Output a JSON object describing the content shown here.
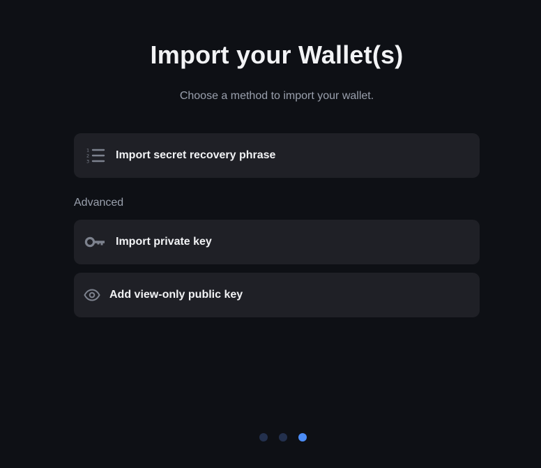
{
  "header": {
    "title": "Import your Wallet(s)",
    "subtitle": "Choose a method to import your wallet."
  },
  "options": [
    {
      "label": "Import secret recovery phrase",
      "icon": "numbered-list-icon"
    },
    {
      "label": "Import private key",
      "icon": "key-icon"
    },
    {
      "label": "Add view-only public key",
      "icon": "eye-icon"
    }
  ],
  "advanced_label": "Advanced",
  "pagination": {
    "total": 3,
    "current": 3
  },
  "colors": {
    "background": "#0e1015",
    "card": "#1f2026",
    "text_primary": "#f2f3f5",
    "text_secondary": "#9aa0ad",
    "icon": "#7d828e",
    "dot_inactive": "#23304d",
    "dot_active": "#4c8df6"
  }
}
